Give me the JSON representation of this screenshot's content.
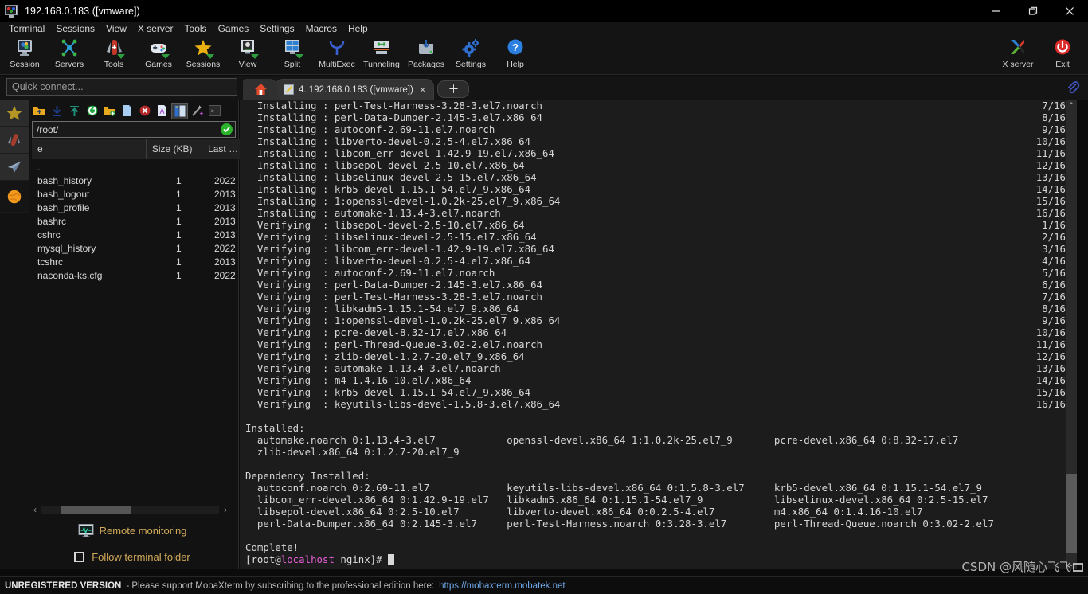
{
  "window": {
    "title": "192.168.0.183 ([vmware])",
    "minimize_label": "minimize",
    "maximize_label": "restore",
    "close_label": "close"
  },
  "menubar": {
    "items": [
      {
        "label": "Terminal"
      },
      {
        "label": "Sessions"
      },
      {
        "label": "View"
      },
      {
        "label": "X server"
      },
      {
        "label": "Tools"
      },
      {
        "label": "Games"
      },
      {
        "label": "Settings"
      },
      {
        "label": "Macros"
      },
      {
        "label": "Help"
      }
    ]
  },
  "toolbar": {
    "items": [
      {
        "label": "Session",
        "icon": "session-icon"
      },
      {
        "label": "Servers",
        "icon": "servers-icon"
      },
      {
        "label": "Tools",
        "icon": "tools-icon"
      },
      {
        "label": "Games",
        "icon": "games-icon"
      },
      {
        "label": "Sessions",
        "icon": "sessions-star-icon"
      },
      {
        "label": "View",
        "icon": "view-icon"
      },
      {
        "label": "Split",
        "icon": "split-icon"
      },
      {
        "label": "MultiExec",
        "icon": "multiexec-icon"
      },
      {
        "label": "Tunneling",
        "icon": "tunneling-icon"
      },
      {
        "label": "Packages",
        "icon": "packages-icon"
      },
      {
        "label": "Settings",
        "icon": "settings-gear-icon"
      },
      {
        "label": "Help",
        "icon": "help-icon"
      }
    ],
    "right_items": [
      {
        "label": "X server",
        "icon": "x-server-icon"
      },
      {
        "label": "Exit",
        "icon": "exit-power-icon"
      }
    ]
  },
  "quick_connect": {
    "placeholder": "Quick connect..."
  },
  "tabs": {
    "home_label": "home",
    "items": [
      {
        "label": "4. 192.168.0.183 ([vmware])",
        "active": true,
        "close_label": "×"
      }
    ],
    "new_tab_label": "＋"
  },
  "rail": {
    "items": [
      {
        "name": "favorites-star-icon"
      },
      {
        "name": "tools-knife-icon"
      },
      {
        "name": "sessions-plane-icon"
      },
      {
        "name": "macros-globe-icon"
      }
    ]
  },
  "sftp": {
    "toolbar_icons": [
      "parent-folder-icon",
      "download-icon",
      "upload-icon",
      "refresh-icon",
      "new-folder-icon",
      "new-file-icon",
      "delete-icon",
      "text-edit-icon",
      "split-view-icon",
      "magic-wand-icon",
      "terminal-icon"
    ],
    "path": "/root/",
    "path_ok_label": "✓",
    "columns": [
      "e",
      "Size (KB)",
      "Last …"
    ],
    "files": [
      {
        "name": ".",
        "size": "",
        "modified": ""
      },
      {
        "name": "bash_history",
        "size": "1",
        "modified": "2022"
      },
      {
        "name": "bash_logout",
        "size": "1",
        "modified": "2013"
      },
      {
        "name": "bash_profile",
        "size": "1",
        "modified": "2013"
      },
      {
        "name": "bashrc",
        "size": "1",
        "modified": "2013"
      },
      {
        "name": "cshrc",
        "size": "1",
        "modified": "2013"
      },
      {
        "name": "mysql_history",
        "size": "1",
        "modified": "2022"
      },
      {
        "name": "tcshrc",
        "size": "1",
        "modified": "2013"
      },
      {
        "name": "naconda-ks.cfg",
        "size": "1",
        "modified": "2022"
      }
    ],
    "scroll_left_label": "‹",
    "scroll_right_label": "›",
    "remote_monitoring_label": "Remote monitoring",
    "follow_terminal_folder_label": "Follow terminal folder",
    "follow_terminal_folder_checked": false
  },
  "terminal": {
    "lines": [
      {
        "text": "  Installing : perl-Test-Harness-3.28-3.el7.noarch",
        "count": "7/16"
      },
      {
        "text": "  Installing : perl-Data-Dumper-2.145-3.el7.x86_64",
        "count": "8/16"
      },
      {
        "text": "  Installing : autoconf-2.69-11.el7.noarch",
        "count": "9/16"
      },
      {
        "text": "  Installing : libverto-devel-0.2.5-4.el7.x86_64",
        "count": "10/16"
      },
      {
        "text": "  Installing : libcom_err-devel-1.42.9-19.el7.x86_64",
        "count": "11/16"
      },
      {
        "text": "  Installing : libsepol-devel-2.5-10.el7.x86_64",
        "count": "12/16"
      },
      {
        "text": "  Installing : libselinux-devel-2.5-15.el7.x86_64",
        "count": "13/16"
      },
      {
        "text": "  Installing : krb5-devel-1.15.1-54.el7_9.x86_64",
        "count": "14/16"
      },
      {
        "text": "  Installing : 1:openssl-devel-1.0.2k-25.el7_9.x86_64",
        "count": "15/16"
      },
      {
        "text": "  Installing : automake-1.13.4-3.el7.noarch",
        "count": "16/16"
      },
      {
        "text": "  Verifying  : libsepol-devel-2.5-10.el7.x86_64",
        "count": "1/16"
      },
      {
        "text": "  Verifying  : libselinux-devel-2.5-15.el7.x86_64",
        "count": "2/16"
      },
      {
        "text": "  Verifying  : libcom_err-devel-1.42.9-19.el7.x86_64",
        "count": "3/16"
      },
      {
        "text": "  Verifying  : libverto-devel-0.2.5-4.el7.x86_64",
        "count": "4/16"
      },
      {
        "text": "  Verifying  : autoconf-2.69-11.el7.noarch",
        "count": "5/16"
      },
      {
        "text": "  Verifying  : perl-Data-Dumper-2.145-3.el7.x86_64",
        "count": "6/16"
      },
      {
        "text": "  Verifying  : perl-Test-Harness-3.28-3.el7.noarch",
        "count": "7/16"
      },
      {
        "text": "  Verifying  : libkadm5-1.15.1-54.el7_9.x86_64",
        "count": "8/16"
      },
      {
        "text": "  Verifying  : 1:openssl-devel-1.0.2k-25.el7_9.x86_64",
        "count": "9/16"
      },
      {
        "text": "  Verifying  : pcre-devel-8.32-17.el7.x86_64",
        "count": "10/16"
      },
      {
        "text": "  Verifying  : perl-Thread-Queue-3.02-2.el7.noarch",
        "count": "11/16"
      },
      {
        "text": "  Verifying  : zlib-devel-1.2.7-20.el7_9.x86_64",
        "count": "12/16"
      },
      {
        "text": "  Verifying  : automake-1.13.4-3.el7.noarch",
        "count": "13/16"
      },
      {
        "text": "  Verifying  : m4-1.4.16-10.el7.x86_64",
        "count": "14/16"
      },
      {
        "text": "  Verifying  : krb5-devel-1.15.1-54.el7_9.x86_64",
        "count": "15/16"
      },
      {
        "text": "  Verifying  : keyutils-libs-devel-1.5.8-3.el7.x86_64",
        "count": "16/16"
      },
      {
        "text": "",
        "count": ""
      },
      {
        "text": "Installed:",
        "count": ""
      },
      {
        "text": "  automake.noarch 0:1.13.4-3.el7            openssl-devel.x86_64 1:1.0.2k-25.el7_9       pcre-devel.x86_64 0:8.32-17.el7",
        "count": ""
      },
      {
        "text": "  zlib-devel.x86_64 0:1.2.7-20.el7_9",
        "count": ""
      },
      {
        "text": "",
        "count": ""
      },
      {
        "text": "Dependency Installed:",
        "count": ""
      },
      {
        "text": "  autoconf.noarch 0:2.69-11.el7             keyutils-libs-devel.x86_64 0:1.5.8-3.el7     krb5-devel.x86_64 0:1.15.1-54.el7_9",
        "count": ""
      },
      {
        "text": "  libcom_err-devel.x86_64 0:1.42.9-19.el7   libkadm5.x86_64 0:1.15.1-54.el7_9            libselinux-devel.x86_64 0:2.5-15.el7",
        "count": ""
      },
      {
        "text": "  libsepol-devel.x86_64 0:2.5-10.el7        libverto-devel.x86_64 0:0.2.5-4.el7          m4.x86_64 0:1.4.16-10.el7",
        "count": ""
      },
      {
        "text": "  perl-Data-Dumper.x86_64 0:2.145-3.el7     perl-Test-Harness.noarch 0:3.28-3.el7        perl-Thread-Queue.noarch 0:3.02-2.el7",
        "count": ""
      },
      {
        "text": "",
        "count": ""
      },
      {
        "text": "Complete!",
        "count": ""
      }
    ],
    "prompt": {
      "prefix": "[root@",
      "host": "localhost",
      "suffix": " nginx]# "
    },
    "scroll_up_label": "⌃",
    "scroll_down_label": "⌄"
  },
  "statusbar": {
    "unregistered": "UNREGISTERED VERSION",
    "message": "-  Please support MobaXterm by subscribing to the professional edition here:",
    "link": "https://mobaxterm.mobatek.net"
  },
  "watermark": {
    "text": "CSDN @风随心飞飞"
  },
  "colors": {
    "accent_blue": "#6fa8e8",
    "prompt_magenta": "#e85fd8",
    "ok_green": "#2cb32c",
    "amber": "#d2ab5a",
    "terminal_bg": "#1c1c1c",
    "chrome_bg": "#141414"
  }
}
